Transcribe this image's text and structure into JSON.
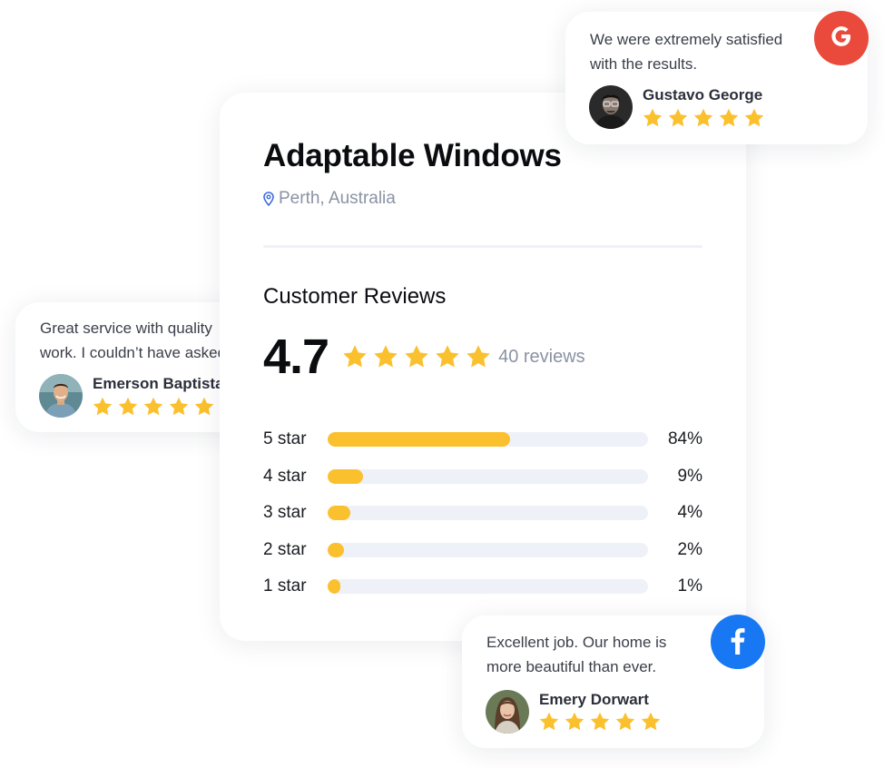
{
  "business": {
    "name": "Adaptable Windows",
    "location": "Perth, Australia"
  },
  "reviews_section": {
    "heading": "Customer Reviews",
    "rating": "4.7",
    "rating_stars": 5,
    "count_text": "40 reviews",
    "distribution": [
      {
        "label": "5 star",
        "percent": 84,
        "percent_text": "84%",
        "bar_fill": 0.57
      },
      {
        "label": "4 star",
        "percent": 9,
        "percent_text": "9%",
        "bar_fill": 0.11
      },
      {
        "label": "3 star",
        "percent": 4,
        "percent_text": "4%",
        "bar_fill": 0.07
      },
      {
        "label": "2 star",
        "percent": 2,
        "percent_text": "2%",
        "bar_fill": 0.05
      },
      {
        "label": "1 star",
        "percent": 1,
        "percent_text": "1%",
        "bar_fill": 0.04
      }
    ]
  },
  "testimonials": {
    "google": {
      "source_icon": "google-icon",
      "text_line1": "We were extremely satisfied",
      "text_line2": "with the results.",
      "name": "Gustavo George",
      "stars": 5
    },
    "emerson": {
      "text_line1": "Great service with quality",
      "text_line2": "work. I couldn’t have asked",
      "name": "Emerson Baptista",
      "stars": 5
    },
    "facebook": {
      "source_icon": "facebook-icon",
      "text_line1": "Excellent job. Our home is",
      "text_line2": "more beautiful than ever.",
      "name": "Emery Dorwart",
      "stars": 5
    }
  },
  "colors": {
    "star": "#FBC02D",
    "bar_track": "#EFF1F9",
    "google_red": "#EA4A3C",
    "facebook_blue": "#1877F2",
    "location_pin": "#3B6CE0"
  }
}
